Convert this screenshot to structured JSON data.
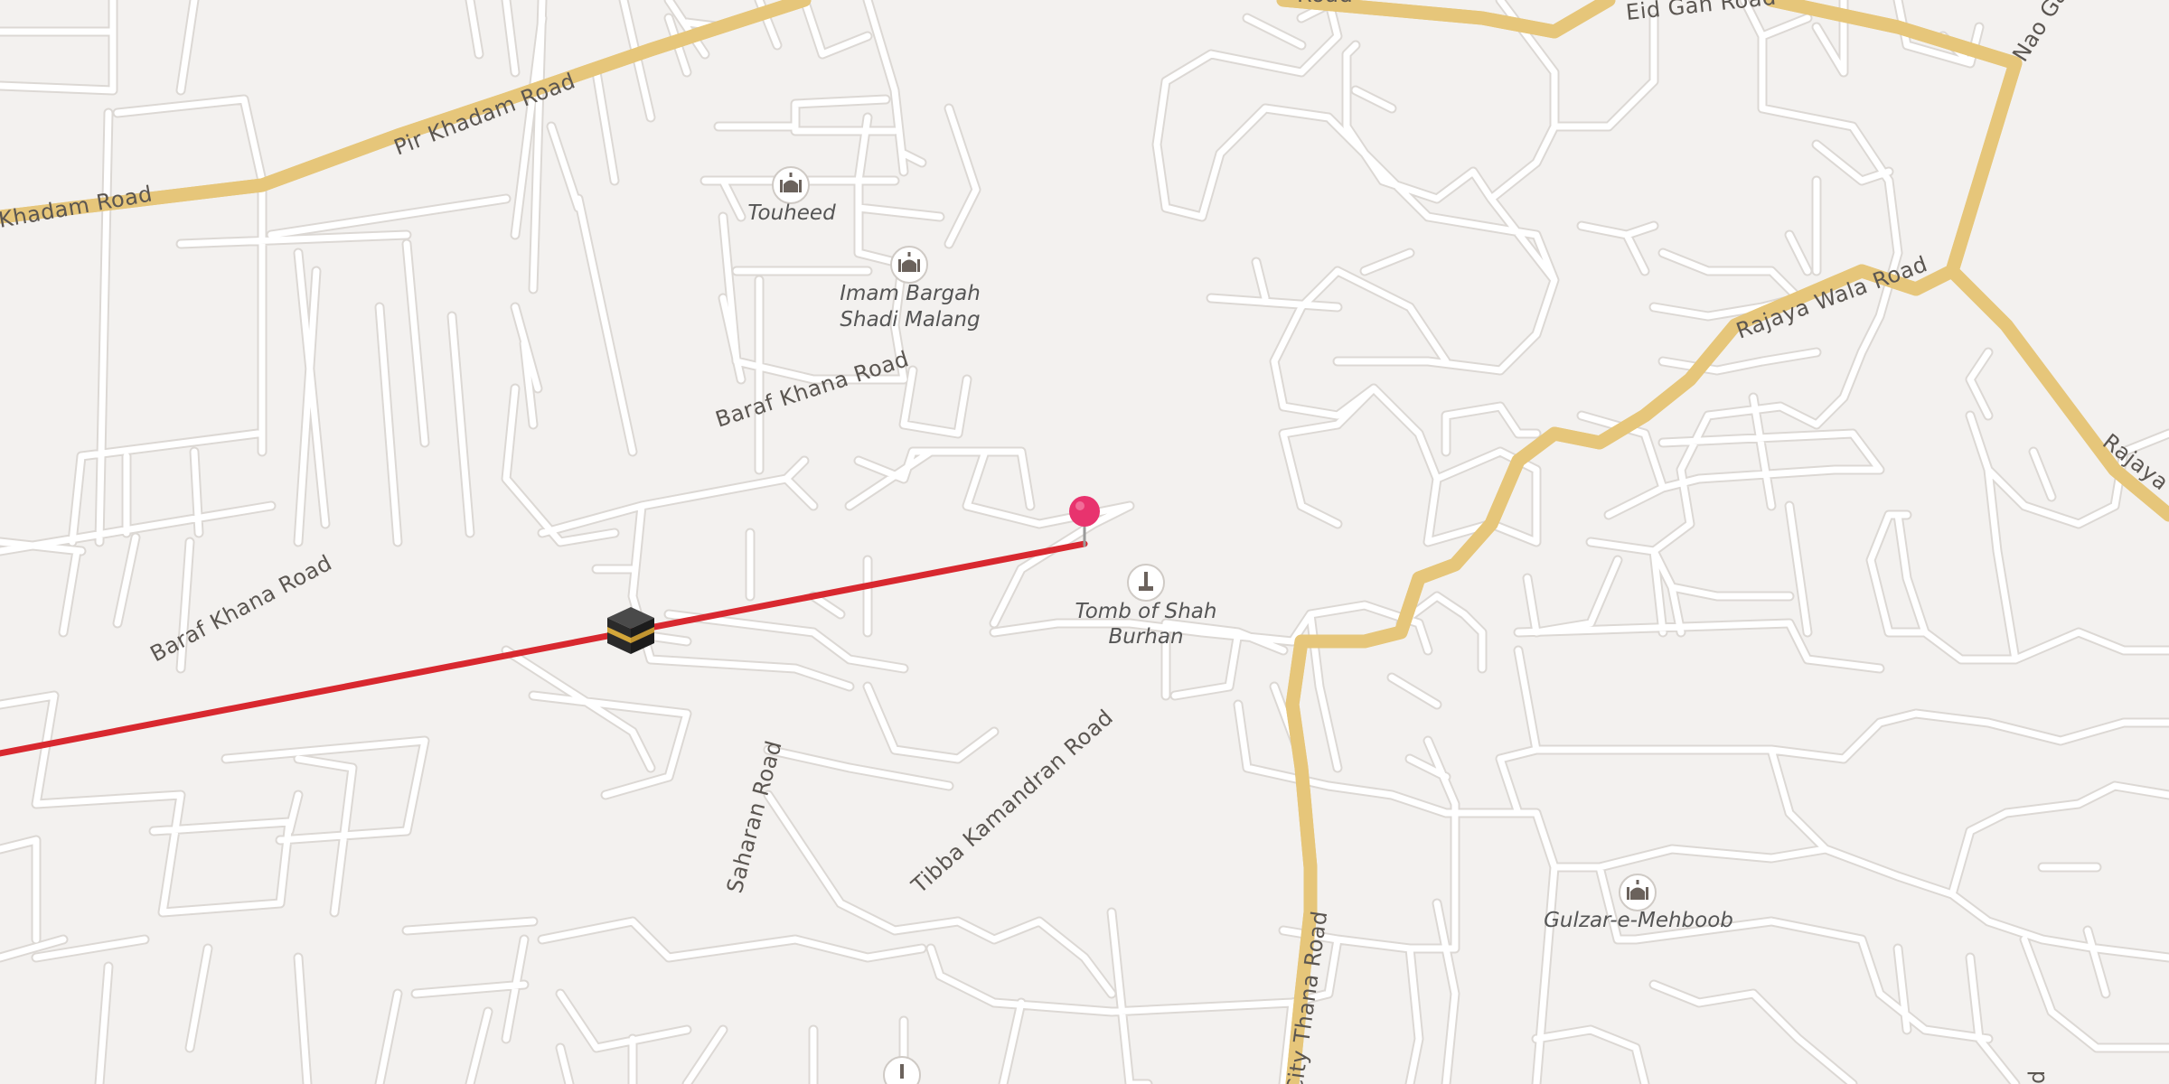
{
  "map": {
    "colors": {
      "background": "#f3f1ef",
      "minor_road": "#ffffff",
      "minor_road_casing": "#dcd8d4",
      "major_road": "#fbe3a0",
      "major_road_casing": "#e6c67a",
      "qibla_line": "#d8282f",
      "pin": "#e8336e",
      "label": "#5b5651"
    },
    "road_labels": {
      "pir_khadam_road": "Pir Khadam Road",
      "khadam_road_left": "Khadam Road",
      "baraf_khana_road_upper": "Baraf Khana Road",
      "baraf_khana_road_lower": "Baraf Khana Road",
      "saharan_road": "Saharan Road",
      "tibba_kamandran_road": "Tibba Kamandran Road",
      "city_thana_road": "City Thana Road",
      "eid_gah_road": "Eid Gah Road",
      "road_top_cut": "Road",
      "rajaya_wala_road": "Rajaya Wala Road",
      "rajaya_wala_road_right": "Rajaya W",
      "nao_gara": "Nao Ga",
      "edge_d_right": "d"
    },
    "poi_labels": {
      "touheed": "Touheed",
      "imam_bargah_line1": "Imam Bargah",
      "imam_bargah_line2": "Shadi Malang",
      "tomb_line1": "Tomb of Shah",
      "tomb_line2": "Burhan",
      "gulzar": "Gulzar-e-Mehboob"
    },
    "icons": {
      "mosque": "mosque-icon",
      "tomb": "tomb-icon",
      "kaaba": "kaaba-icon",
      "pin": "location-pin-icon"
    }
  }
}
